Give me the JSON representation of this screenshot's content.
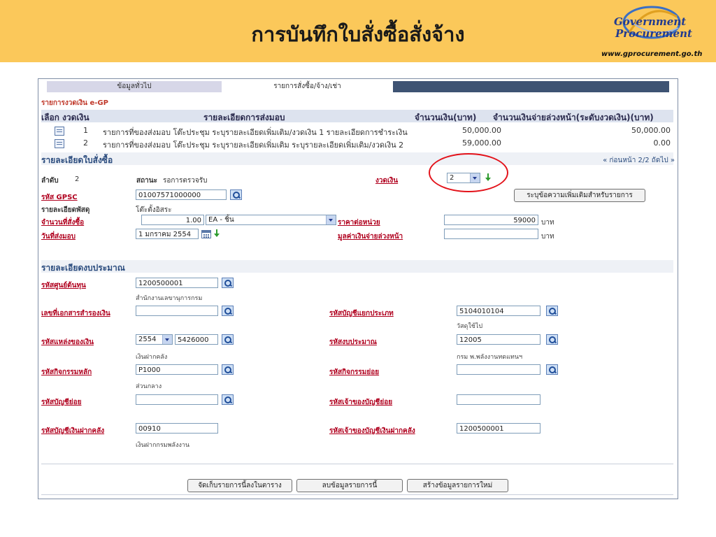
{
  "banner": {
    "title": "การบันทึกใบสั่งซื้อสั่งจ้าง",
    "logo_line1": "Government",
    "logo_line2": "Procurement",
    "logo_url": "www.gprocurement.go.th"
  },
  "tabs": [
    "ข้อมูลทั่วไป",
    "รายการสั่งซื้อ/จ้าง/เช่า"
  ],
  "installments": {
    "heading": "รายการงวดเงิน e-GP",
    "columns": [
      "เลือก",
      "งวดเงิน",
      "รายละเอียดการส่งมอบ",
      "จำนวนเงิน(บาท)",
      "จำนวนเงินจ่ายล่วงหน้า(ระดับงวดเงิน)(บาท)"
    ],
    "rows": [
      {
        "no": "1",
        "detail": "รายการที่ของส่งมอบ โต๊ะประชุม ระบุรายละเอียดเพิ่มเติม/งวดเงิน 1 รายละเอียดการชำระเงิน",
        "amount": "50,000.00",
        "advance": "50,000.00"
      },
      {
        "no": "2",
        "detail": "รายการที่ของส่งมอบ โต๊ะประชุม ระบุรายละเอียดเพิ่มเติม ระบุรายละเอียดเพิ่มเติม/งวดเงิน 2",
        "amount": "59,000.00",
        "advance": "0.00"
      }
    ]
  },
  "order": {
    "heading": "รายละเอียดใบสั่งซื้อ",
    "pager": "« ก่อนหน้า 2/2 ถัดไป »",
    "seq_label": "ลำดับ",
    "seq_value": "2",
    "status_label": "สถานะ",
    "status_value": "รอการตรวจรับ",
    "installment_label": "งวดเงิน",
    "installment_value": "2",
    "gpsc_label": "รหัส GPSC",
    "gpsc_value": "01007571000000",
    "extra_button": "ระบุข้อความเพิ่มเติมสำหรับรายการ",
    "material_label": "รายละเอียดพัสดุ",
    "material_value": "โต๊ะตั้งอิสระ",
    "qty_label": "จำนวนที่สั่งซื้อ",
    "qty_value": "1.00",
    "unit_value": "EA - ชิ้น",
    "unit_price_label": "ราคาต่อหน่วย",
    "unit_price_value": "59000",
    "baht1": "บาท",
    "delivery_label": "วันที่ส่งมอบ",
    "delivery_value": "1 มกราคม 2554",
    "advance_label": "มูลค่าเงินจ่ายล่วงหน้า",
    "advance_value": "",
    "baht2": "บาท"
  },
  "budget": {
    "heading": "รายละเอียดงบประมาณ",
    "cost_center_label": "รหัสศูนย์ต้นทุน",
    "cost_center_value": "1200500001",
    "cost_center_hint": "สำนักงานเลขานุการกรม",
    "reserve_doc_label": "เลขที่เอกสารสำรองเงิน",
    "reserve_doc_value": "",
    "gl_label": "รหัสบัญชีแยกประเภท",
    "gl_value": "5104010104",
    "gl_hint": "วัสดุใช้ไป",
    "fund_label": "รหัสแหล่งของเงิน",
    "fund_year": "2554",
    "fund_value": "5426000",
    "fund_hint": "เงินฝากคลัง",
    "budget_code_label": "รหัสงบประมาณ",
    "budget_code_value": "12005",
    "budget_code_hint": "กรม พ.พลังงานทดแทนฯ",
    "activity_label": "รหัสกิจกรรมหลัก",
    "activity_value": "P1000",
    "activity_hint": "ส่วนกลาง",
    "sub_activity_label": "รหัสกิจกรรมย่อย",
    "sub_activity_value": "",
    "sub_account_label": "รหัสบัญชีย่อย",
    "sub_account_value": "",
    "sub_account_owner_label": "รหัสเจ้าของบัญชีย่อย",
    "sub_account_owner_value": "",
    "deposit_label": "รหัสบัญชีเงินฝากคลัง",
    "deposit_value": "00910",
    "deposit_hint": "เงินฝากกรมพลังงาน",
    "deposit_owner_label": "รหัสเจ้าของบัญชีเงินฝากคลัง",
    "deposit_owner_value": "1200500001"
  },
  "actions": {
    "save": "จัดเก็บรายการนี้ลงในตาราง",
    "delete": "ลบข้อมูลรายการนี้",
    "create": "สร้างข้อมูลรายการใหม่"
  },
  "colors": {
    "banner": "#fbc85a",
    "section_text": "#2b4c7e",
    "link_red": "#b0001e",
    "highlight_ring": "#e3121a"
  }
}
